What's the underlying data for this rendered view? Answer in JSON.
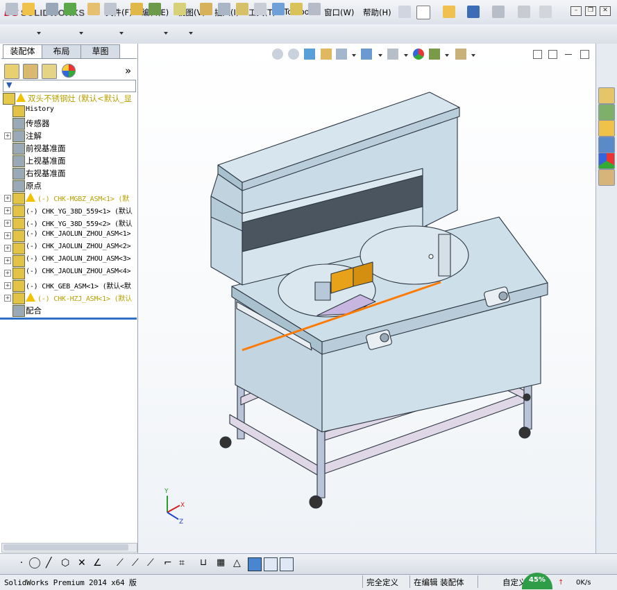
{
  "app": {
    "logo_ds": "DS",
    "logo_name": "SOLIDWORKS"
  },
  "menu": {
    "items": [
      "文件(F)",
      "编辑(E)",
      "视图(V)",
      "插入(I)",
      "工具(T)",
      "Toolbox",
      "窗口(W)",
      "帮助(H)"
    ]
  },
  "tabs": [
    "装配体",
    "布局",
    "草图"
  ],
  "panel": {
    "collapse_glyph": "»",
    "tree": [
      {
        "label": "双头不锈钢灶  (默认<默认_显",
        "style": "root",
        "warn": true
      },
      {
        "label": "History",
        "style": "mono"
      },
      {
        "label": "传感器",
        "style": "normal"
      },
      {
        "label": "注解",
        "style": "normal",
        "expand": true
      },
      {
        "label": "前视基准面",
        "style": "normal"
      },
      {
        "label": "上视基准面",
        "style": "normal"
      },
      {
        "label": "右视基准面",
        "style": "normal"
      },
      {
        "label": "原点",
        "style": "normal"
      },
      {
        "label": "(-) CHK-MGBZ_ASM<1> (默",
        "style": "yellow",
        "warn": true,
        "expand": true
      },
      {
        "label": "(-) CHK_YG_38D_559<1> (默认",
        "style": "mono",
        "expand": true
      },
      {
        "label": "(-) CHK_YG_38D_559<2> (默认",
        "style": "mono",
        "expand": true
      },
      {
        "label": "(-) CHK_JAOLUN_ZHOU_ASM<1>",
        "style": "mono",
        "expand": true
      },
      {
        "label": "(-) CHK_JAOLUN_ZHOU_ASM<2>",
        "style": "mono",
        "expand": true
      },
      {
        "label": "(-) CHK_JAOLUN_ZHOU_ASM<3>",
        "style": "mono",
        "expand": true
      },
      {
        "label": "(-) CHK_JAOLUN_ZHOU_ASM<4>",
        "style": "mono",
        "expand": true
      },
      {
        "label": "(-) CHK_GEB_ASM<1> (默认<默",
        "style": "mono",
        "expand": true
      },
      {
        "label": "(-) CHK-HZJ_ASM<1> (默认",
        "style": "yellow",
        "warn": true,
        "expand": true
      },
      {
        "label": "配合",
        "style": "normal"
      }
    ]
  },
  "triad": {
    "x": "X",
    "y": "Y",
    "z": "Z"
  },
  "status": {
    "version": "SolidWorks Premium 2014 x64 版",
    "state1": "完全定义",
    "state2": "在编辑 装配体",
    "state3": "自定义",
    "net_percent": "45%",
    "net_speed": "0K/s"
  },
  "colors": {
    "cabinet": "#c9dce7",
    "cabinet_dark": "#9fb7c6",
    "outline": "#2b3540",
    "leg": "#b9c4d8",
    "crossbar": "#dfd6e6",
    "orange_line": "#ff7a00",
    "bracket": "#e8a21a"
  }
}
